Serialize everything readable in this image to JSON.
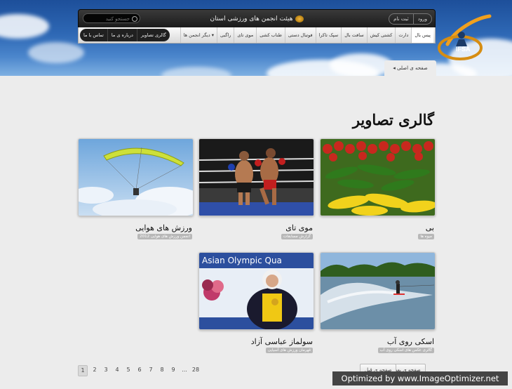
{
  "header": {
    "site_title": "هیئت انجمن های ورزشی استان سمنان",
    "search_placeholder": "جستجو کنید",
    "auth": [
      "ثبت نام",
      "ورود"
    ],
    "brand_text": "IFSA",
    "nav_items": [
      "پیس بال",
      "دارت",
      "کشتی کیش",
      "سافت بال",
      "سپک تاکرا",
      "فوتبال دستی",
      "طناب کشی",
      "موی تای",
      "راگبی",
      "دیگر انجمن ها"
    ],
    "nav_dark": [
      "گالری تصاویر",
      "درباره ی ما",
      "تماس با ما"
    ],
    "breadcrumb": "صفحه ی اصلی"
  },
  "page": {
    "title": "گالری تصاویر"
  },
  "gallery": [
    {
      "title": "بی",
      "tag": "میوه ها"
    },
    {
      "title": "موی تای",
      "tag": "گزارش مسابقات"
    },
    {
      "title": "ورزش های هوایی",
      "tag": "انجمن ورزش های هوایی 2012"
    },
    {
      "title": "اسکی روی آب",
      "tag": "گالری عکس های اسکی روی آب"
    },
    {
      "title": "سولماز عباسی آزاد",
      "tag": "قهرمان ورزش های آسیایی"
    }
  ],
  "pagination": {
    "pages": [
      "1",
      "2",
      "3",
      "4",
      "5",
      "6",
      "7",
      "8",
      "9",
      "...",
      "28"
    ],
    "current": "1",
    "next_label": "صفحه ی بعد",
    "prev_label": "صفحه ی قبل"
  },
  "watermark": "Optimized by www.ImageOptimizer.net",
  "colors": {
    "hero_blue": "#2e68b5",
    "topbar": "#1a1a1a",
    "brand_orange": "#f0a01e",
    "tag_gray": "#b8b8b8"
  }
}
